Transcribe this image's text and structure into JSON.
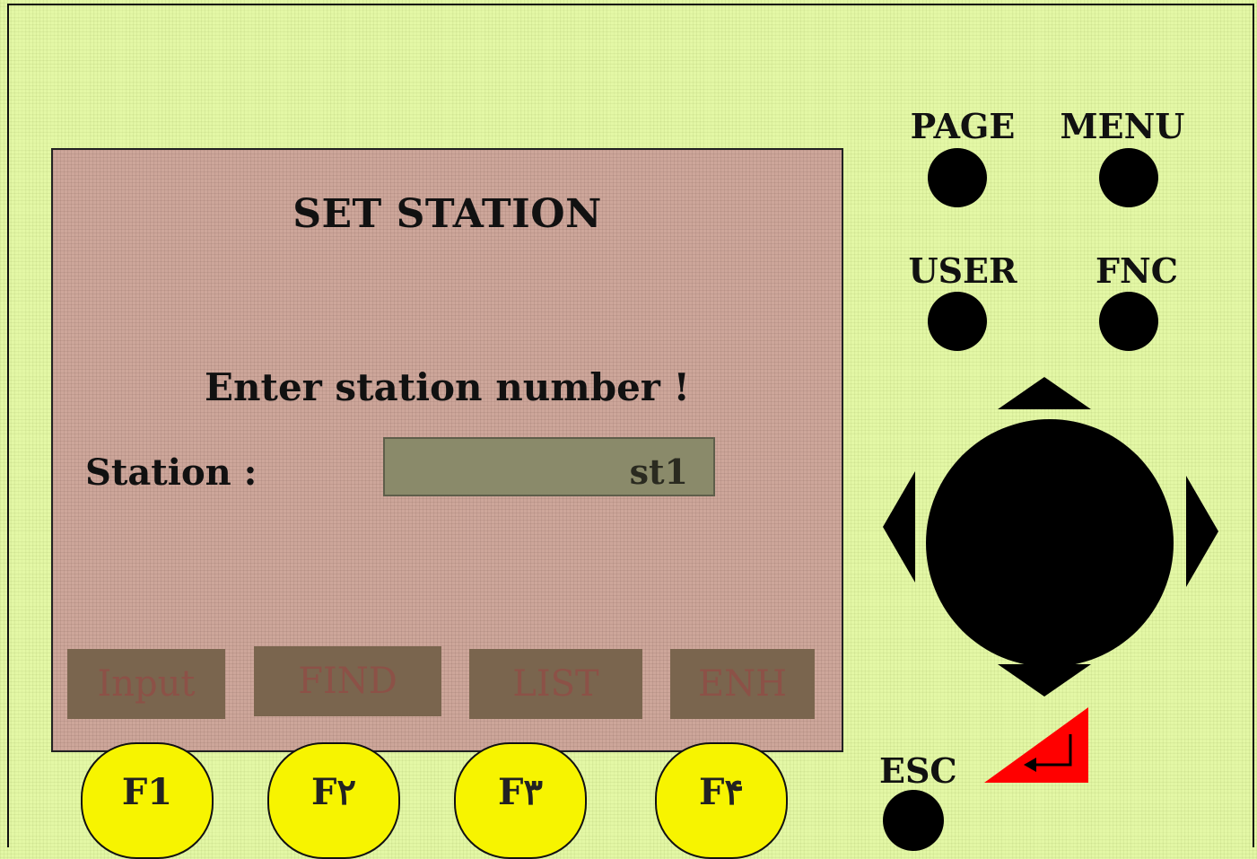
{
  "screen": {
    "title": "SET STATION",
    "prompt": "Enter station number !",
    "station_label": "Station :",
    "station_value": "st1",
    "softkeys": [
      "Input",
      "FIND",
      "LIST",
      "ENH"
    ]
  },
  "keypad": {
    "page_label": "PAGE",
    "menu_label": "MENU",
    "user_label": "USER",
    "fnc_label": "FNC",
    "esc_label": "ESC"
  },
  "function_keys": [
    "F1",
    "F۲",
    "F۳",
    "F۴"
  ],
  "colors": {
    "background": "#e4f8a6",
    "screen": "#cda69a",
    "function_key": "#f7f400",
    "enter_key": "#ff0000"
  }
}
